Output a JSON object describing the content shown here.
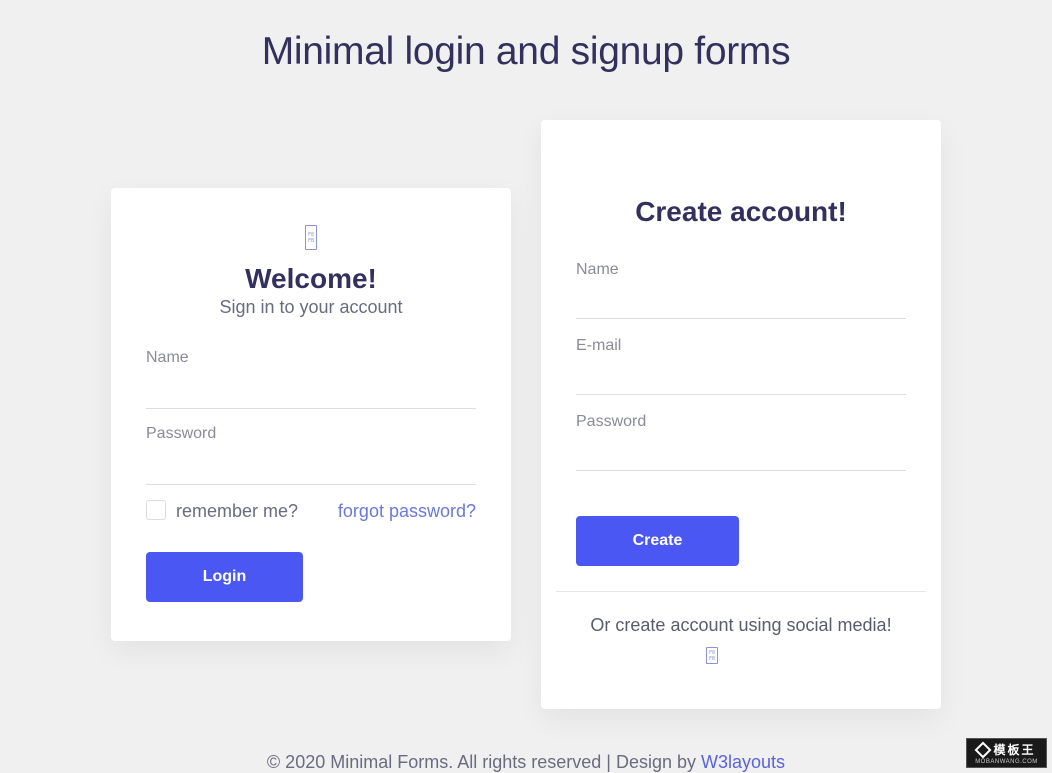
{
  "page": {
    "title": "Minimal login and signup forms"
  },
  "login": {
    "icon_glyph_top": "F8",
    "icon_glyph_bottom": "FB",
    "heading": "Welcome!",
    "subheading": "Sign in to your account",
    "name_label": "Name",
    "name_value": "",
    "password_label": "Password",
    "password_value": "",
    "remember_label": "remember me?",
    "remember_checked": false,
    "forgot_link": "forgot password?",
    "submit_label": "Login"
  },
  "signup": {
    "heading": "Create account!",
    "name_label": "Name",
    "name_value": "",
    "email_label": "E-mail",
    "email_value": "",
    "password_label": "Password",
    "password_value": "",
    "submit_label": "Create",
    "social_text": "Or create account using social media!",
    "social_glyph_top": "F8",
    "social_glyph_bottom": "FB"
  },
  "footer": {
    "text": "© 2020 Minimal Forms. All rights reserved | Design by ",
    "link_text": "W3layouts"
  },
  "watermark": {
    "title": "模板王",
    "url": "MOBANWANG.COM"
  },
  "colors": {
    "background": "#f0f0f0",
    "card": "#ffffff",
    "heading": "#33305e",
    "button": "#4a57f2",
    "link": "#6a79d9"
  }
}
